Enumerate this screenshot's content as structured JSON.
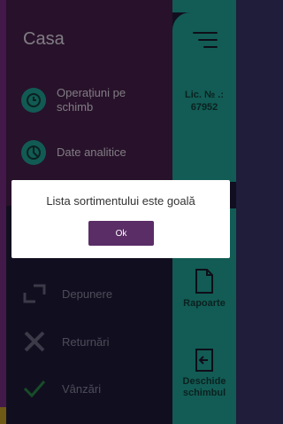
{
  "header": {
    "title": "Casa"
  },
  "menu": {
    "operations_label": "Operațiuni pe schimb",
    "analytics_label": "Date analitice"
  },
  "license": {
    "label": "Lic. № .:",
    "number": "67952"
  },
  "actions": {
    "deposit_label": "Depunere",
    "returns_label": "Returnări",
    "sales_label": "Vânzări",
    "reports_label": "Rapoarte",
    "open_shift_label": "Deschide schimbul"
  },
  "dialog": {
    "message": "Lista sortimentului este goală",
    "ok_label": "Ok"
  },
  "colors": {
    "purple_card": "#4a1f4e",
    "teal": "#22a89b",
    "background": "#1f1d3a",
    "ok_button": "#5a2d66"
  }
}
